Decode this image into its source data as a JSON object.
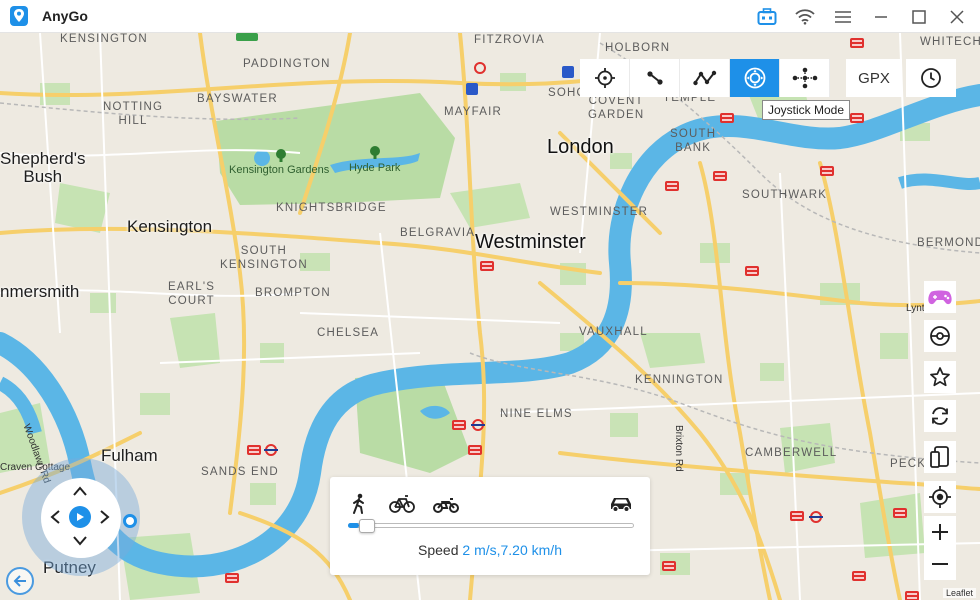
{
  "app": {
    "name": "AnyGo"
  },
  "colors": {
    "accent": "#1e90e8",
    "water": "#5bb6e6",
    "park": "#b9dca5",
    "road_major": "#f6cf6b"
  },
  "titlebar_icons": [
    "toolbox-icon",
    "wifi-icon",
    "menu-icon",
    "minimize-icon",
    "maximize-icon",
    "close-icon"
  ],
  "modes": [
    {
      "name": "teleport-mode",
      "icon": "crosshair-icon"
    },
    {
      "name": "two-spot-mode",
      "icon": "two-spot-icon"
    },
    {
      "name": "multi-spot-mode",
      "icon": "multi-spot-icon"
    },
    {
      "name": "joystick-mode",
      "icon": "joystick-icon",
      "active": true
    },
    {
      "name": "jump-teleport-mode",
      "icon": "jump-teleport-icon"
    }
  ],
  "gpx_label": "GPX",
  "tooltip": "Joystick Mode",
  "map_labels": {
    "london": "London",
    "westminster": "Westminster",
    "kensington": "Kensington",
    "fulham": "Fulham",
    "putney": "Putney",
    "shepherds_bush": "Shepherd's\nBush",
    "hammersmith": "nmersmith",
    "kensington_top": "KENSINGTON",
    "paddington": "PADDINGTON",
    "bayswater": "BAYSWATER",
    "notting_hill": "NOTTING\nHILL",
    "fitzrovia": "FITZROVIA",
    "holborn": "HOLBORN",
    "whitechapel": "WHITECHE",
    "soho": "SOHO",
    "mayfair": "MAYFAIR",
    "temple": "TEMPLE",
    "covent_garden": "COVENT\nGARDEN",
    "south_bank": "SOUTH\nBANK",
    "southwark": "SOUTHWARK",
    "bermondsey": "BERMONDS",
    "knightsbridge": "KNIGHTSBRIDGE",
    "belgravia": "BELGRAVIA",
    "westminster_small": "WESTMINSTER",
    "south_kensington": "SOUTH\nKENSINGTON",
    "earls_court": "EARL'S\nCOURT",
    "brompton": "BROMPTON",
    "chelsea": "CHELSEA",
    "vauxhall": "VAUXHALL",
    "kennington": "KENNINGTON",
    "nine_elms": "NINE ELMS",
    "camberwell": "CAMBERWELL",
    "sands_end": "SANDS END",
    "peckham": "PECK",
    "kensington_gardens": "Kensington Gardens",
    "hyde_park": "Hyde Park",
    "craven_cottage": "Craven Cottage",
    "woodlawn_rd": "Woodlawn Rd",
    "brixton_rd": "Brixton Rd",
    "lynton_rd": "Lynton Rd"
  },
  "speed_panel": {
    "transports": [
      "walk-icon",
      "bike-icon",
      "motorbike-icon",
      "car-icon"
    ],
    "speed_label": "Speed",
    "speed_value": "2 m/s,7.20 km/h",
    "slider_fraction": 0.04
  },
  "side_tools": [
    "game-controller-icon",
    "pokeball-icon",
    "star-icon",
    "refresh-icon",
    "devices-icon",
    "locate-icon",
    "zoom-in-icon",
    "zoom-out-icon"
  ],
  "attribution": "Leaflet"
}
